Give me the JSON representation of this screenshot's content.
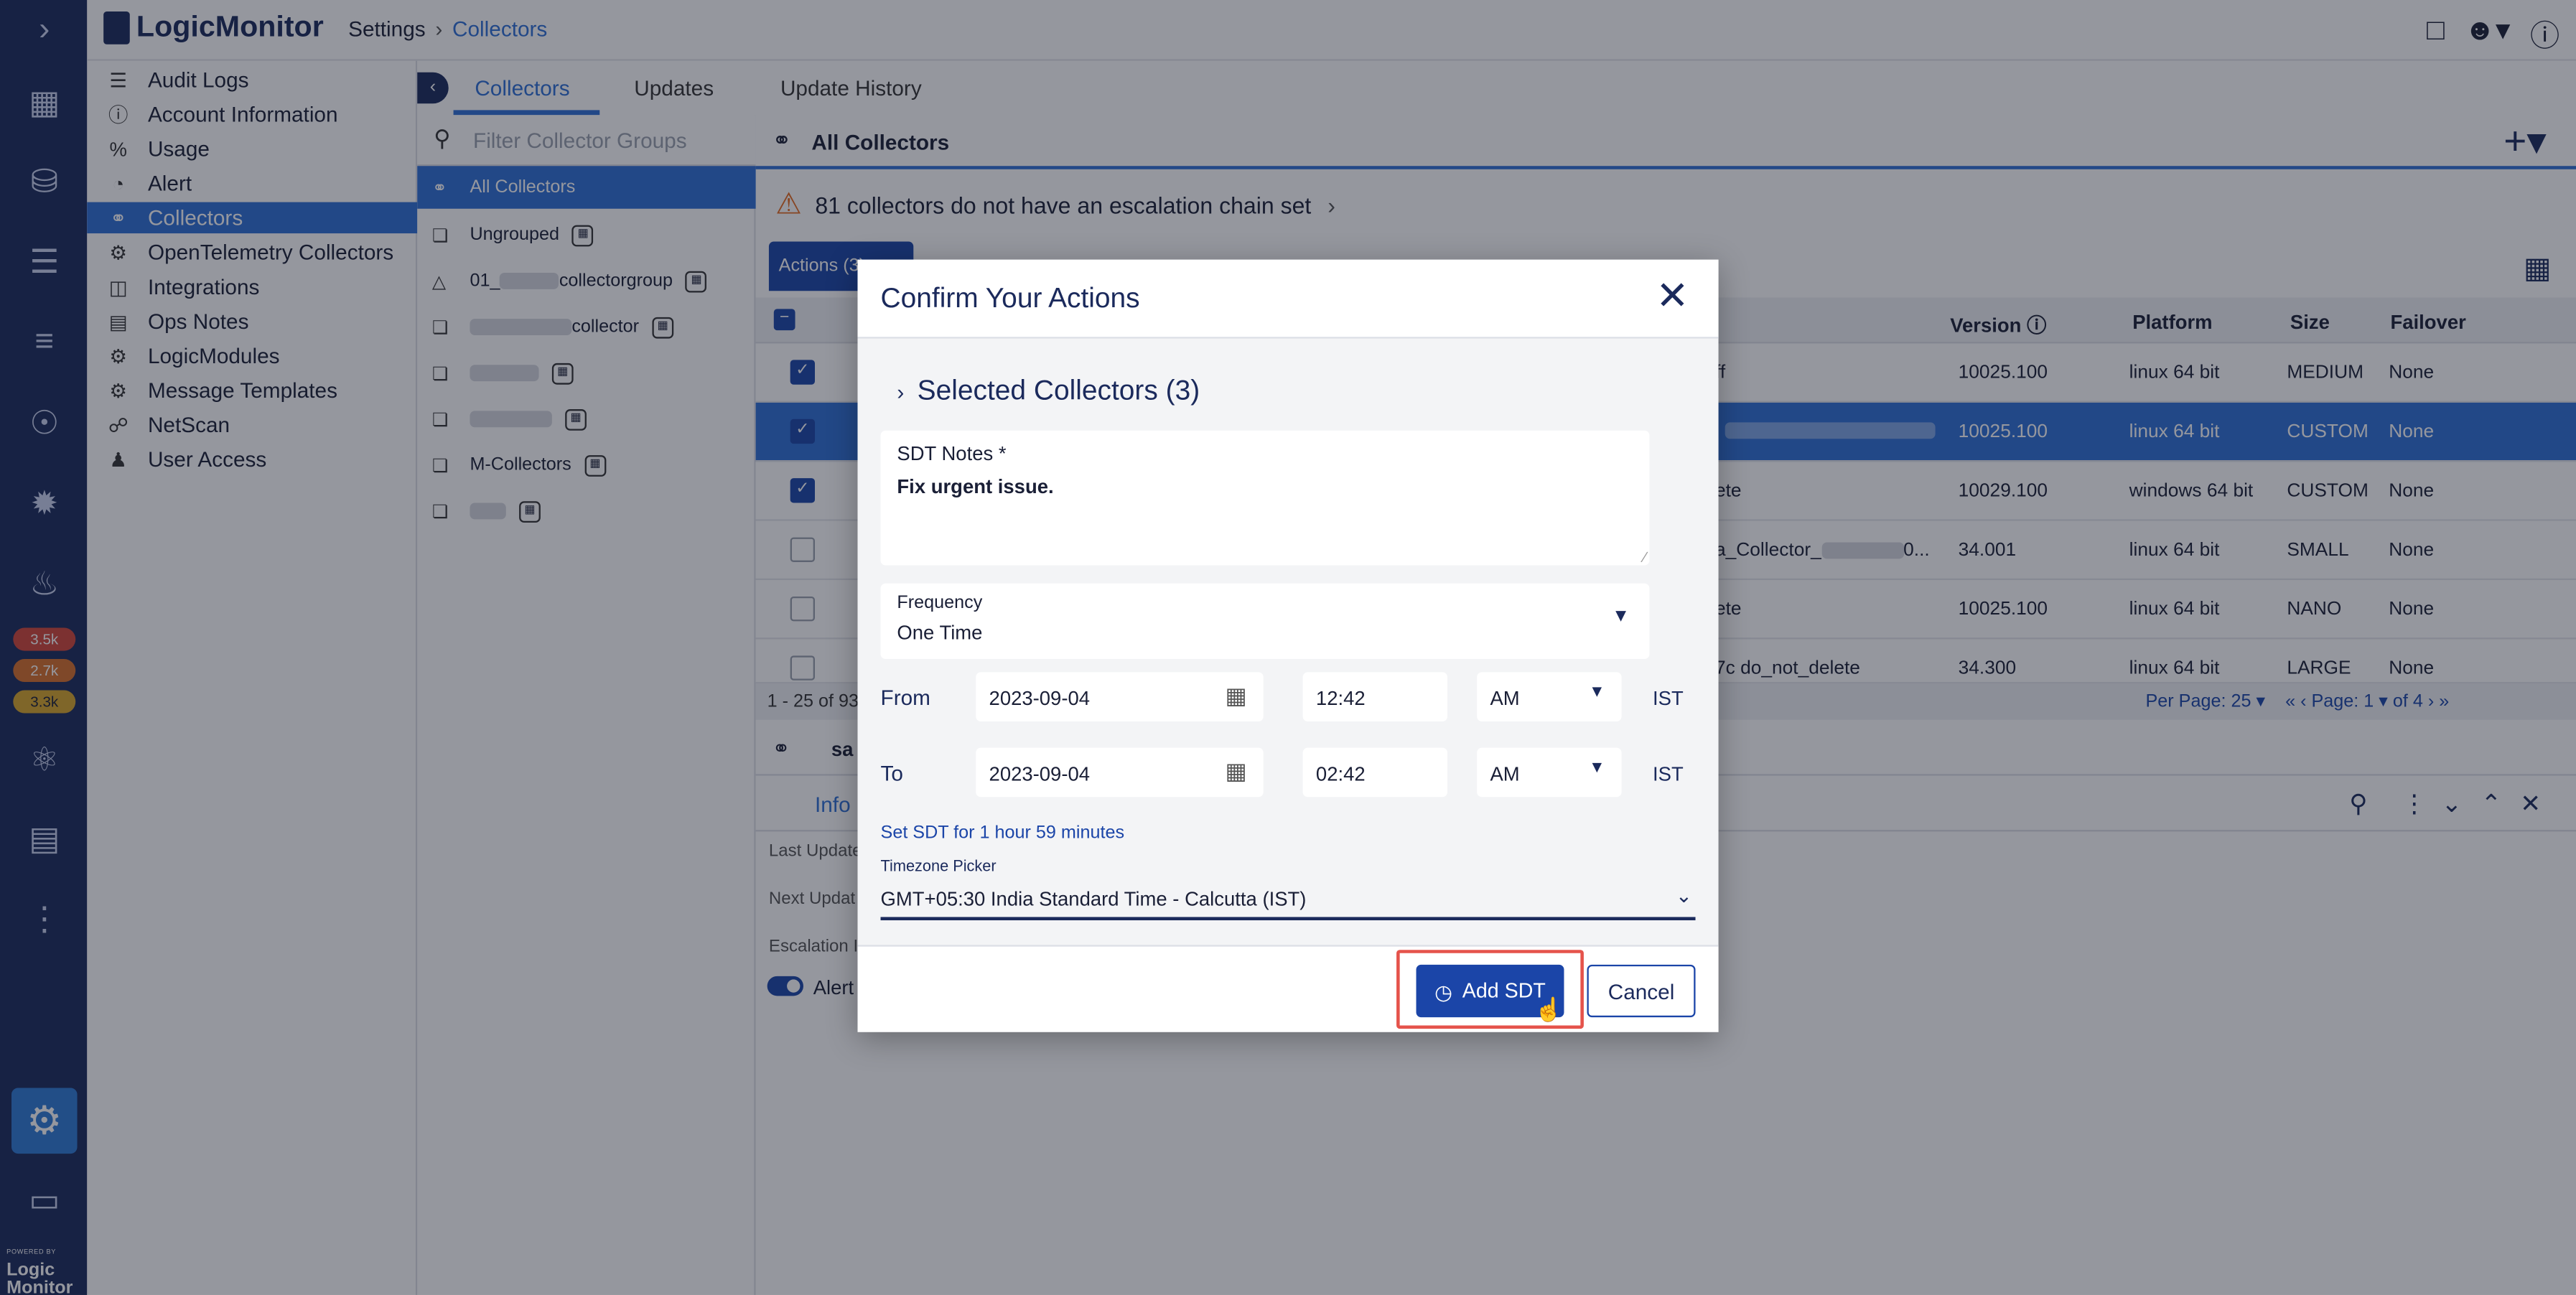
{
  "brand": {
    "name": "LogicMonitor",
    "powered_by": "POWERED BY",
    "footer_logo": "Logic Monitor"
  },
  "rail": {
    "badges": [
      {
        "label": "3.5k",
        "color": "#d2453a"
      },
      {
        "label": "2.7k",
        "color": "#d8702a"
      },
      {
        "label": "3.3k",
        "color": "#d8a72a"
      }
    ]
  },
  "breadcrumb": {
    "root": "Settings",
    "current": "Collectors"
  },
  "settings_nav": {
    "items": [
      {
        "label": "Audit Logs",
        "icon": "list-icon"
      },
      {
        "label": "Account Information",
        "icon": "info-icon"
      },
      {
        "label": "Usage",
        "icon": "percent-icon"
      },
      {
        "label": "Alert",
        "icon": "alert-icon"
      },
      {
        "label": "Collectors",
        "icon": "collector-icon",
        "active": true
      },
      {
        "label": "OpenTelemetry Collectors",
        "icon": "gear-icon"
      },
      {
        "label": "Integrations",
        "icon": "integrations-icon"
      },
      {
        "label": "Ops Notes",
        "icon": "notes-icon"
      },
      {
        "label": "LogicModules",
        "icon": "gear-icon"
      },
      {
        "label": "Message Templates",
        "icon": "gear-icon"
      },
      {
        "label": "NetScan",
        "icon": "netscan-icon"
      },
      {
        "label": "User Access",
        "icon": "user-lock-icon"
      }
    ]
  },
  "tabs": {
    "collectors": "Collectors",
    "updates": "Updates",
    "update_history": "Update History"
  },
  "groups": {
    "filter_placeholder": "Filter Collector Groups",
    "items": [
      {
        "label": "All Collectors",
        "active": true
      },
      {
        "label": "Ungrouped"
      },
      {
        "label": "01_",
        "suffix": "collectorgroup"
      },
      {
        "label": "",
        "suffix": "collector"
      },
      {
        "label": ""
      },
      {
        "label": ""
      },
      {
        "label": "M-Collectors"
      },
      {
        "label": ""
      }
    ]
  },
  "main": {
    "title": "All Collectors",
    "warning": "81 collectors do not have an escalation chain set",
    "actions_label": "Actions (3)",
    "columns": {
      "version": "Version",
      "platform": "Platform",
      "size": "Size",
      "failover": "Failover"
    },
    "rows": [
      {
        "checked": true,
        "desc": "ff",
        "version": "10025.100",
        "platform": "linux 64 bit",
        "size": "MEDIUM",
        "failover": "None"
      },
      {
        "checked": true,
        "selected": true,
        "desc": "",
        "version": "10025.100",
        "platform": "linux 64 bit",
        "size": "CUSTOM",
        "failover": "None"
      },
      {
        "checked": true,
        "desc": "ete",
        "version": "10029.100",
        "platform": "windows 64 bit",
        "size": "CUSTOM",
        "failover": "None"
      },
      {
        "checked": false,
        "desc": "a_Collector_",
        "desc2": "0...",
        "version": "34.001",
        "platform": "linux 64 bit",
        "size": "SMALL",
        "failover": "None"
      },
      {
        "checked": false,
        "desc": "ete",
        "version": "10025.100",
        "platform": "linux 64 bit",
        "size": "NANO",
        "failover": "None"
      },
      {
        "checked": false,
        "desc": "7c do_not_delete",
        "version": "34.300",
        "platform": "linux 64 bit",
        "size": "LARGE",
        "failover": "None"
      }
    ],
    "pager_left": "1 - 25 of 93",
    "per_page": "Per Page: 25",
    "page_label": "Page:",
    "page_num": "1",
    "page_of": "of 4",
    "detail_title": "sa",
    "info_tab": "Info",
    "labels": {
      "last_update": "Last Update",
      "next_update": "Next Updat",
      "escalation": "Escalation I",
      "alert": "Alert"
    }
  },
  "modal": {
    "title": "Confirm Your Actions",
    "selected": "Selected Collectors (3)",
    "notes_label": "SDT Notes *",
    "notes_value": "Fix urgent issue.",
    "frequency_label": "Frequency",
    "frequency_value": "One Time",
    "from_label": "From",
    "to_label": "To",
    "from_date": "2023-09-04",
    "from_time": "12:42",
    "from_ampm": "AM",
    "to_date": "2023-09-04",
    "to_time": "02:42",
    "to_ampm": "AM",
    "tz_short": "IST",
    "sdt_for": "Set SDT for 1 hour 59 minutes",
    "tz_label": "Timezone Picker",
    "tz_value": "GMT+05:30 India Standard Time - Calcutta (IST)",
    "add_sdt": "Add SDT",
    "cancel": "Cancel"
  }
}
